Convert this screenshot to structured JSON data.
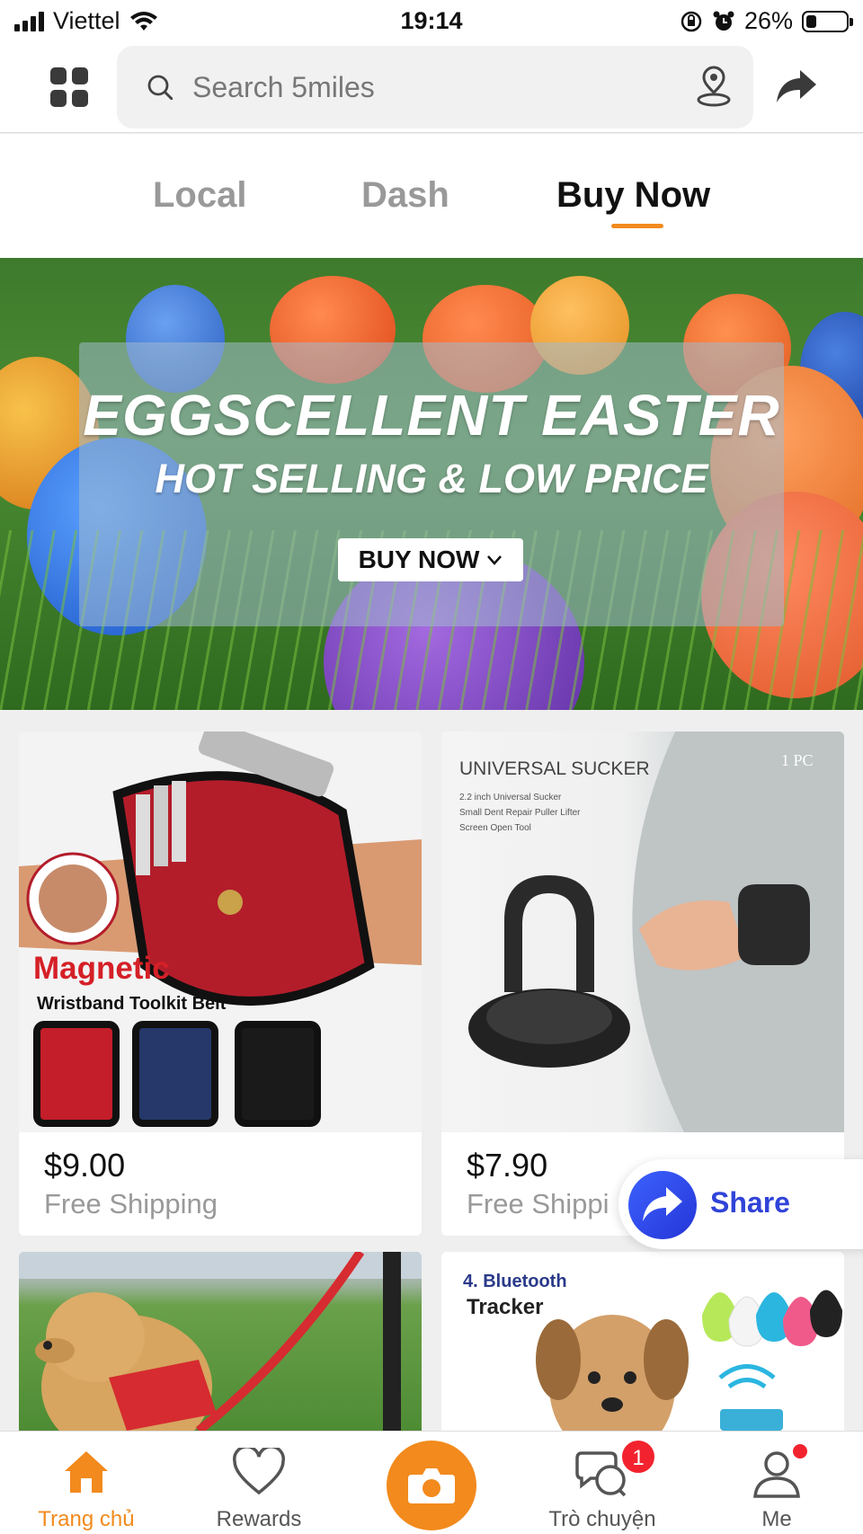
{
  "status_bar": {
    "carrier": "Viettel",
    "time": "19:14",
    "battery_percent": "26%",
    "battery_level": 0.26,
    "icons": [
      "signal-icon",
      "wifi-icon",
      "orientation-lock-icon",
      "alarm-icon",
      "battery-icon"
    ]
  },
  "header": {
    "search_placeholder": "Search 5miles",
    "icons": [
      "grid-menu-icon",
      "search-icon",
      "location-pin-icon",
      "share-arrow-icon"
    ]
  },
  "tabs": [
    {
      "label": "Local",
      "active": false
    },
    {
      "label": "Dash",
      "active": false
    },
    {
      "label": "Buy Now",
      "active": true
    }
  ],
  "banner": {
    "title": "EGGSCELLENT EASTER",
    "subtitle": "HOT SELLING & LOW PRICE",
    "button_label": "BUY NOW"
  },
  "products": [
    {
      "image_lines": {
        "big": "Magnetic",
        "small": "Wristband Toolkit Belt"
      },
      "price": "$9.00",
      "shipping": "Free Shipping"
    },
    {
      "image_lines": {
        "big": "UNIVERSAL SUCKER",
        "corner": "1 PC",
        "small1": "2.2 inch Universal Sucker",
        "small2": "Small Dent Repair Puller Lifter",
        "small3": "Screen Open Tool"
      },
      "price": "$7.90",
      "shipping": "Free Shippi"
    },
    {
      "image_lines": {}
    },
    {
      "image_lines": {
        "big": "4. Bluetooth",
        "small": "Tracker"
      }
    }
  ],
  "share_popup": {
    "label": "Share"
  },
  "bottom_nav": [
    {
      "label": "Trang chủ",
      "active": true,
      "icon": "home-icon"
    },
    {
      "label": "Rewards",
      "active": false,
      "icon": "heart-icon"
    },
    {
      "label": "",
      "active": false,
      "icon": "camera-icon"
    },
    {
      "label": "Trò chuyện",
      "active": false,
      "icon": "chat-icon",
      "badge": "1"
    },
    {
      "label": "Me",
      "active": false,
      "icon": "profile-icon"
    }
  ],
  "colors": {
    "accent": "#f28a1d",
    "share_blue": "#3043d8",
    "badge_red": "#f2232e"
  }
}
